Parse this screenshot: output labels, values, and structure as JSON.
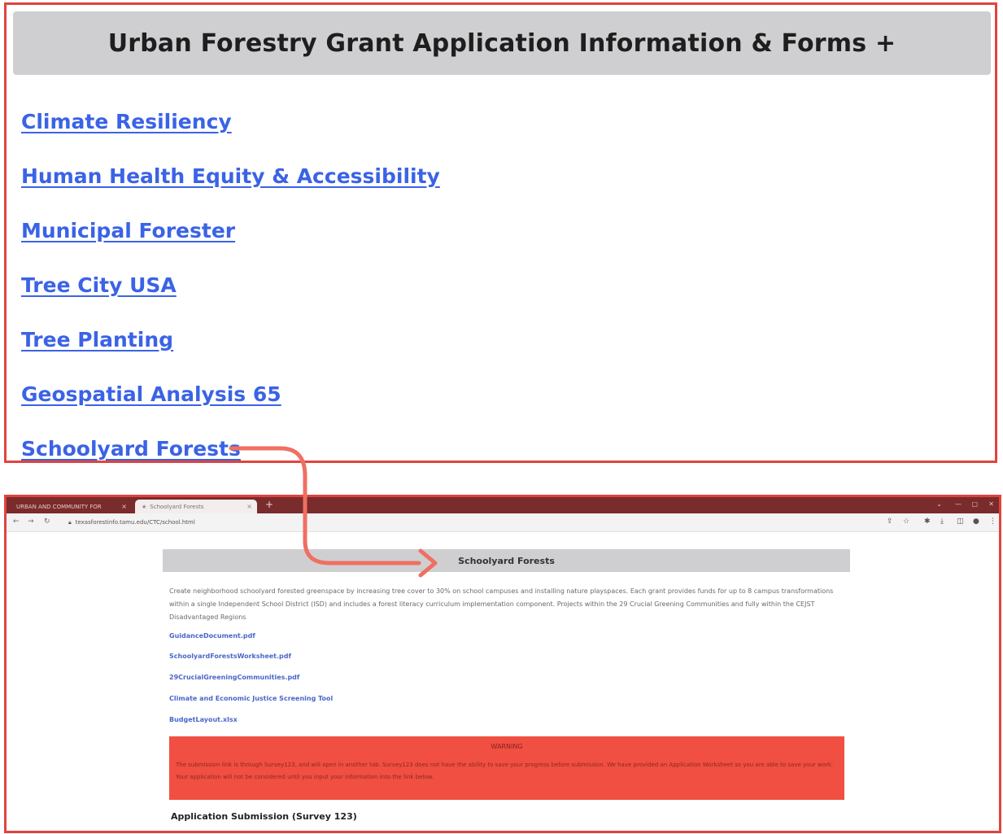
{
  "top": {
    "title": "Urban Forestry Grant Application Information & Forms +",
    "links": [
      "Climate Resiliency",
      "Human Health Equity & Accessibility",
      "Municipal Forester",
      "Tree City USA",
      "Tree Planting",
      "Geospatial Analysis 65",
      "Schoolyard Forests"
    ]
  },
  "browser": {
    "tabs": [
      "URBAN AND COMMUNITY FOR",
      "Schoolyard Forests"
    ],
    "new_tab": "+",
    "url": "texasforestinfo.tamu.edu/CTC/school.html"
  },
  "page": {
    "title": "Schoolyard Forests",
    "description": "Create neighborhood schoolyard forested greenspace by increasing tree cover to 30% on school campuses and installing nature playspaces. Each grant provides funds for up to 8 campus transformations within a single Independent School District (ISD) and includes a forest literacy curriculum implementation component. Projects within the 29 Crucial Greening Communities and fully within the CEJST Disadvantaged Regions",
    "links": [
      "GuidanceDocument.pdf",
      "SchoolyardForestsWorksheet.pdf",
      "29CrucialGreeningCommunities.pdf",
      "Climate and Economic Justice Screening Tool",
      "BudgetLayout.xlsx"
    ],
    "warning": {
      "title": "WARNING",
      "text": "The submission link is through Survey123, and will open in another tab. Survey123 does not have the ability to save your progress before submission. We have provided an Application Worksheet so you are able to save your work. Your application will not be considered until you input your information into the link below."
    },
    "submission": "Application Submission (Survey 123)"
  },
  "colors": {
    "frame": "#e0443e",
    "link": "#3b63e6",
    "header_bg": "#cfcfd1",
    "warning_bg": "#f04f41",
    "tab_bar": "#7a2b2b"
  }
}
